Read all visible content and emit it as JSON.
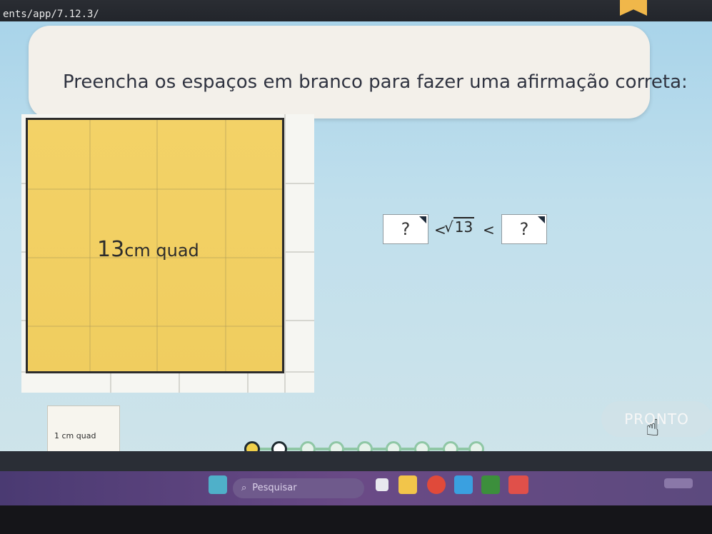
{
  "browser": {
    "url": "ents/app/7.12.3/"
  },
  "exercise": {
    "prompt": "Preencha os espaços em branco para fazer uma afirmação correta:",
    "big_square_value": "13",
    "big_square_unit": "cm quad",
    "small_square_label": "1 cm quad",
    "blank_left": "?",
    "blank_right": "?",
    "less_than": "<",
    "radicand": "13",
    "radical_sign": "√",
    "done_button": "PRONTO"
  },
  "progress": {
    "total": 9,
    "current_index": 0
  },
  "taskbar": {
    "search_placeholder": "Pesquisar"
  },
  "colors": {
    "background_top": "#a9d4ea",
    "yellow_square": "#f2d063",
    "progress_green": "#8fc7a5",
    "taskbar": "#5c4a7e"
  }
}
